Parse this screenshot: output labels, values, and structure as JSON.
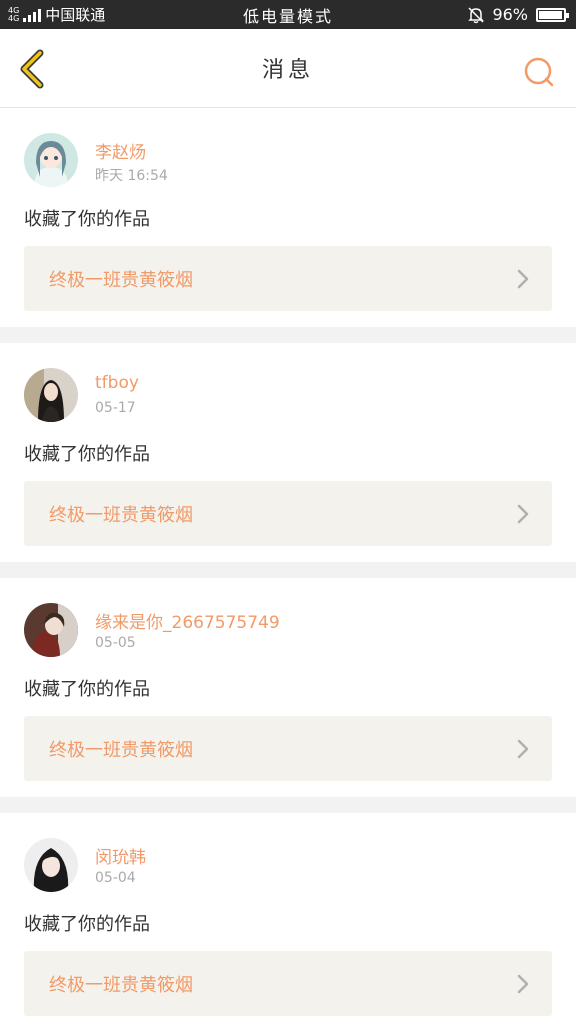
{
  "status_bar": {
    "net_top": "4G",
    "net_bottom": "4G",
    "carrier": "中国联通",
    "mode": "低电量模式",
    "battery": "96%",
    "battery_level": 0.96
  },
  "header": {
    "title": "消息"
  },
  "messages": [
    {
      "username": "李赵炀",
      "time": "昨天 16:54",
      "action": "收藏了你的作品",
      "work_title": "终极一班贵黄筱烟"
    },
    {
      "username": "tfboy",
      "time": "05-17",
      "action": "收藏了你的作品",
      "work_title": "终极一班贵黄筱烟"
    },
    {
      "username": "缘来是你_2667575749",
      "time": "05-05",
      "action": "收藏了你的作品",
      "work_title": "终极一班贵黄筱烟"
    },
    {
      "username": "闵玧韩",
      "time": "05-04",
      "action": "收藏了你的作品",
      "work_title": "终极一班贵黄筱烟"
    }
  ],
  "colors": {
    "accent": "#f29a68",
    "back_icon": "#f0c419",
    "work_bg": "#f3f2ec",
    "status_bg": "#2b2b2b"
  }
}
